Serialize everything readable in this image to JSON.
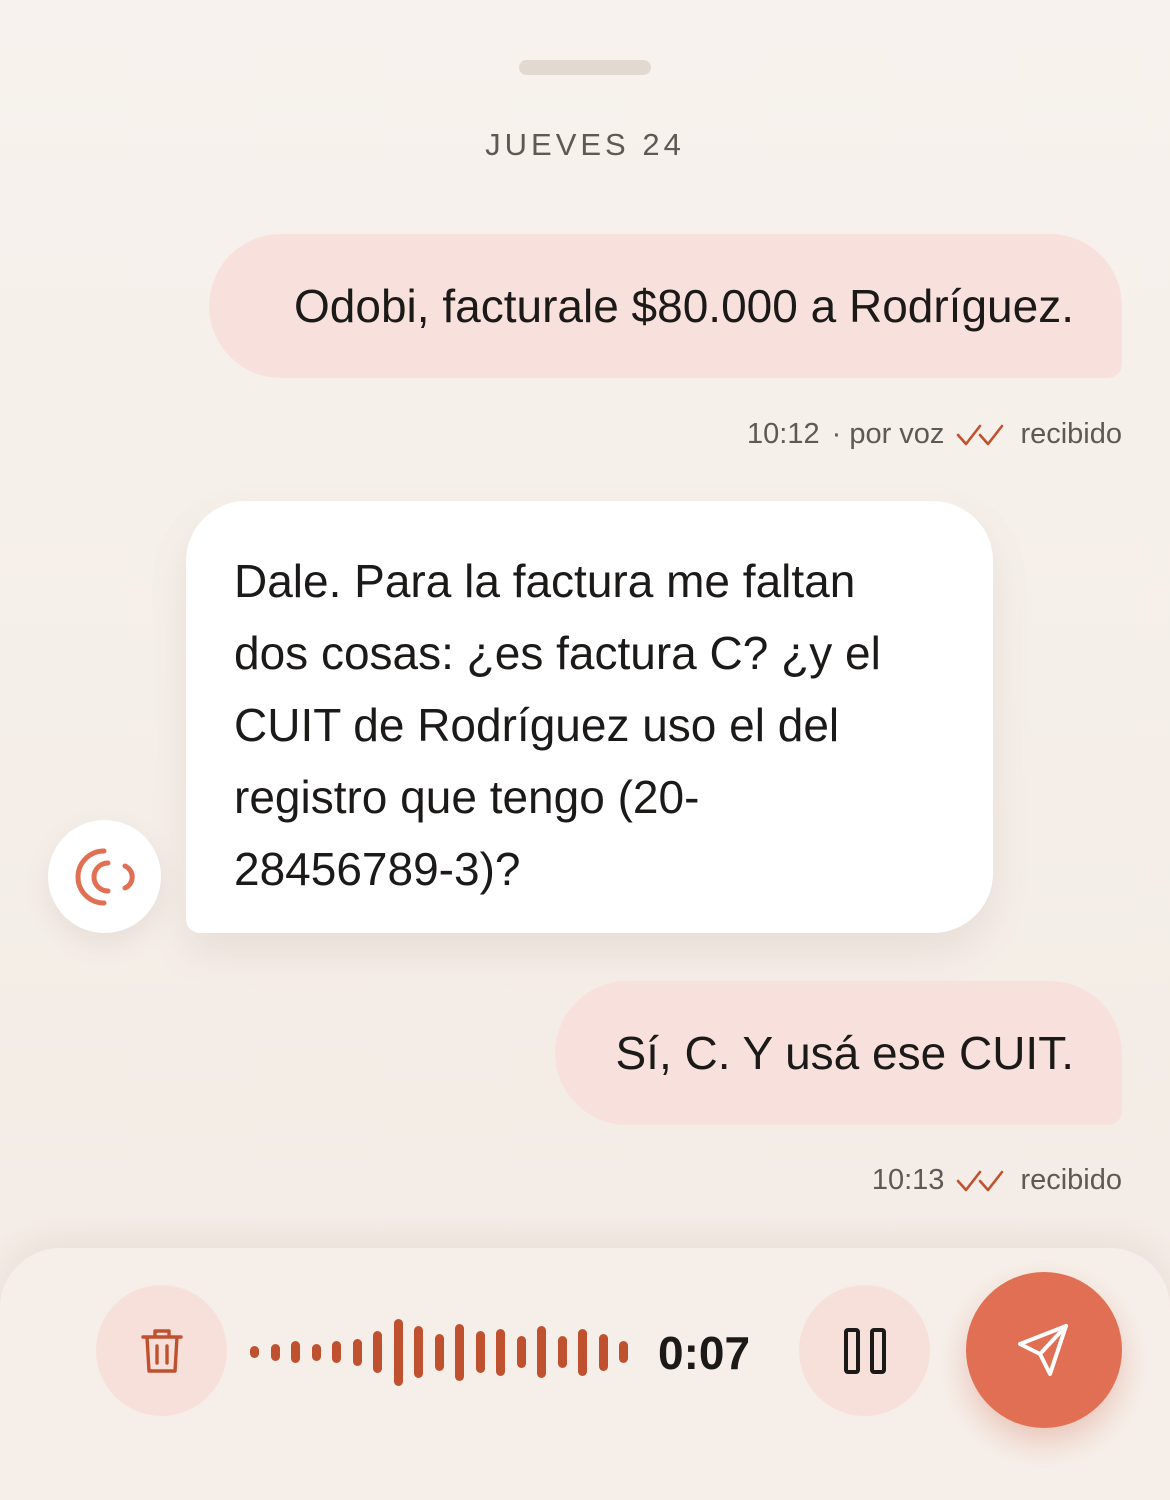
{
  "header": {
    "day_label": "JUEVES 24"
  },
  "messages": [
    {
      "from": "user",
      "text": "Odobi, facturale $80.000 a Rodríguez.",
      "time": "10:12",
      "via": "· por voz",
      "status": "recibido"
    },
    {
      "from": "assistant",
      "text": "Dale. Para la factura me faltan dos cosas: ¿es factura C? ¿y el CUIT de Rodríguez uso el del registro que tengo (20-28456789-3)?",
      "lines": [
        "Dale. Para la factura me faltan",
        "dos cosas: ¿es factura C? ¿y el",
        "CUIT de Rodríguez uso el del",
        "registro que tengo (20-",
        "28456789-3)?"
      ]
    },
    {
      "from": "user",
      "text": "Sí, C. Y usá ese CUIT.",
      "time": "10:13",
      "status": "recibido"
    }
  ],
  "composer": {
    "recording_time": "0:07",
    "waveform_levels": [
      0.14,
      0.2,
      0.26,
      0.2,
      0.26,
      0.32,
      0.5,
      0.8,
      0.62,
      0.44,
      0.68,
      0.5,
      0.56,
      0.38,
      0.62,
      0.38,
      0.56,
      0.44,
      0.26
    ]
  },
  "icons": {
    "agent_avatar": "voice-waves-icon",
    "delete": "trash-icon",
    "pause": "pause-icon",
    "send": "send-icon",
    "status": "double-check-icon"
  },
  "colors": {
    "accent": "#e06f53",
    "accent_dark": "#c0512f",
    "user_bubble": "#f8e1dc",
    "assistant_bubble": "#ffffff",
    "background": "#f5efe9"
  }
}
